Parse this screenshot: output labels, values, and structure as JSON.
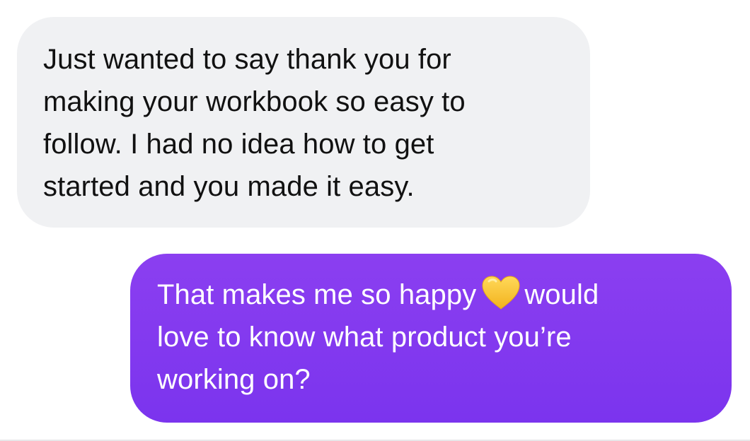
{
  "messages": [
    {
      "sender": "them",
      "lines": [
        "Just wanted to say thank you for",
        "making your workbook so easy to",
        "follow. I had no idea how to get",
        "started and you made it easy."
      ]
    },
    {
      "sender": "me",
      "line1_before": "That makes me so happy",
      "line1_after": "would",
      "emoji": "yellow-heart-icon",
      "lines": [
        "love to know what product you’re",
        "working on?"
      ]
    }
  ],
  "colors": {
    "received_bubble": "#f0f1f3",
    "received_text": "#111111",
    "sent_bubble": "#7b34ee",
    "sent_text": "#ffffff",
    "heart": "#f7c531"
  }
}
